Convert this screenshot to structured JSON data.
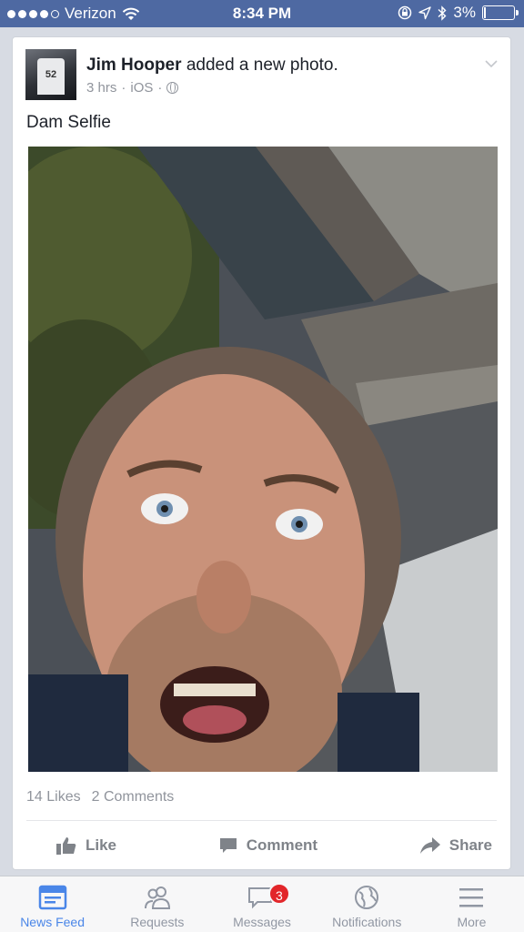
{
  "status_bar": {
    "carrier": "Verizon",
    "time": "8:34 PM",
    "battery": "3%",
    "battery_level": 0.03,
    "signal_bars": 4
  },
  "post": {
    "author": "Jim Hooper",
    "action": "added a new photo.",
    "time_ago": "3 hrs",
    "source": "iOS",
    "caption": "Dam Selfie",
    "likes": "14 Likes",
    "comments": "2 Comments",
    "avatar_jersey_text": "52"
  },
  "actions": {
    "like": "Like",
    "comment": "Comment",
    "share": "Share"
  },
  "tabs": [
    {
      "label": "News Feed",
      "icon": "news-feed-icon",
      "active": true
    },
    {
      "label": "Requests",
      "icon": "friends-icon",
      "active": false
    },
    {
      "label": "Messages",
      "icon": "messages-icon",
      "active": false,
      "badge": "3"
    },
    {
      "label": "Notifications",
      "icon": "globe-icon",
      "active": false
    },
    {
      "label": "More",
      "icon": "menu-icon",
      "active": false
    }
  ],
  "colors": {
    "status_bar": "#4e69a2",
    "active_tab": "#4a86e8",
    "badge": "#e2262a"
  }
}
